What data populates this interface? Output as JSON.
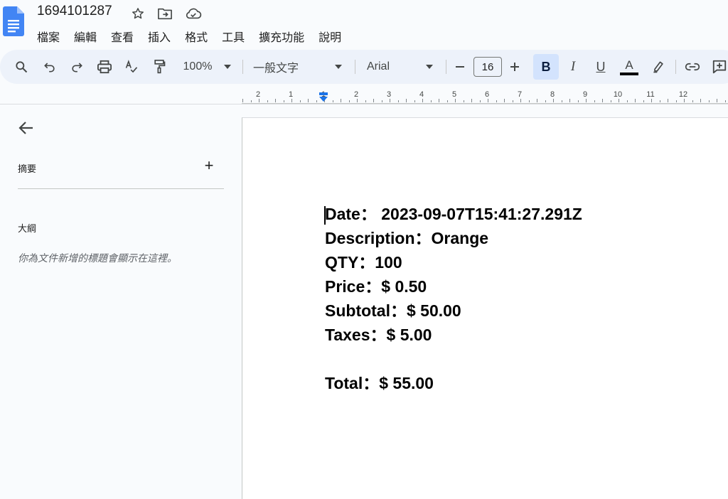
{
  "window": {
    "doc_title": "1694101287"
  },
  "menu": {
    "items": [
      "檔案",
      "編輯",
      "查看",
      "插入",
      "格式",
      "工具",
      "擴充功能",
      "說明"
    ]
  },
  "toolbar": {
    "zoom": "100%",
    "style": "一般文字",
    "font": "Arial",
    "font_size": "16",
    "bold_label": "B",
    "italic_label": "I",
    "underline_label": "U",
    "text_color_label": "A"
  },
  "ruler": {
    "labels": [
      "2",
      "1",
      "1",
      "2",
      "3",
      "4",
      "5",
      "6",
      "7",
      "8",
      "9",
      "10",
      "11",
      "12"
    ]
  },
  "side_panel": {
    "summary_label": "摘要",
    "add_label": "+",
    "outline_label": "大綱",
    "outline_hint": "你為文件新增的標題會顯示在這裡。"
  },
  "document": {
    "lines": [
      "Date： 2023-09-07T15:41:27.291Z",
      "Description：Orange",
      "QTY：100",
      "Price：$ 0.50",
      "Subtotal：$ 50.00",
      "Taxes：$ 5.00",
      "",
      "Total：$ 55.00"
    ]
  },
  "colors": {
    "accent": "#1a73e8",
    "toolbar_bg": "#edf2fa",
    "bold_active_bg": "#d3e3fd"
  }
}
